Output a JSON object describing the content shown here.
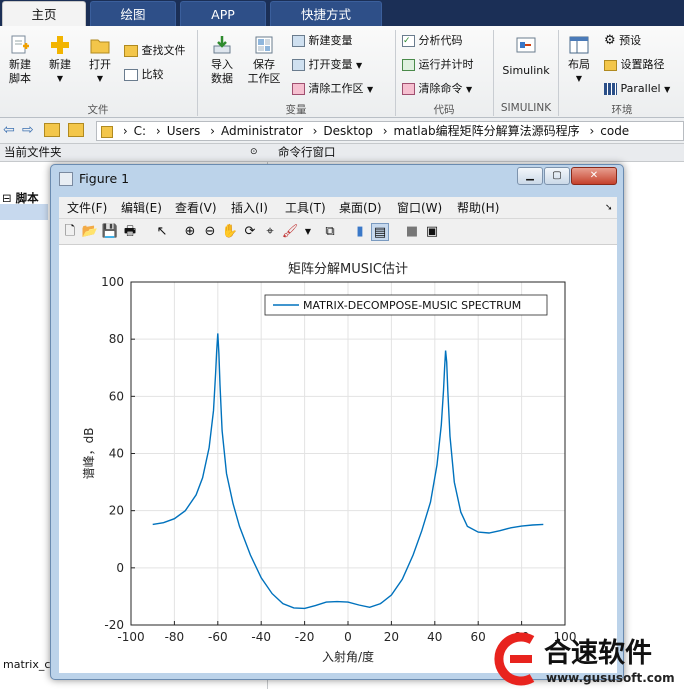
{
  "tabs": [
    {
      "label": "主页",
      "active": true
    },
    {
      "label": "绘图",
      "active": false
    },
    {
      "label": "APP",
      "active": false
    },
    {
      "label": "快捷方式",
      "active": false
    }
  ],
  "ribbon": {
    "file_group": "文件",
    "new_script": "新建\n脚本",
    "new": "新建",
    "open": "打开",
    "find_files": "查找文件",
    "compare": "比较",
    "variable_group": "变量",
    "import_data": "导入\n数据",
    "save_workspace": "保存\n工作区",
    "new_variable": "新建变量",
    "open_variable": "打开变量",
    "clear_workspace": "清除工作区",
    "code_group": "代码",
    "analyze_code": "分析代码",
    "run_and_time": "运行并计时",
    "clear_commands": "清除命令",
    "simulink_group": "SIMULINK",
    "simulink": "Simulink",
    "env_group": "环境",
    "layout": "布局",
    "preferences": "预设",
    "set_path": "设置路径",
    "parallel": "Parallel"
  },
  "address": {
    "path": [
      "C:",
      "Users",
      "Administrator",
      "Desktop",
      "matlab编程矩阵分解算法源码程序",
      "code"
    ]
  },
  "panels": {
    "current_folder": "当前文件夹",
    "command_window": "命令行窗口",
    "tree_root": "脚本",
    "bottom_file": "matrix_c"
  },
  "figure": {
    "title": "Figure 1",
    "menus": [
      "文件(F)",
      "编辑(E)",
      "查看(V)",
      "插入(I)",
      "工具(T)",
      "桌面(D)",
      "窗口(W)",
      "帮助(H)"
    ]
  },
  "chart_data": {
    "type": "line",
    "title": "矩阵分解MUSIC估计",
    "xlabel": "入射角/度",
    "ylabel": "谱峰，dB",
    "xlim": [
      -100,
      100
    ],
    "ylim": [
      -20,
      100
    ],
    "xticks": [
      -100,
      -80,
      -60,
      -40,
      -20,
      0,
      20,
      40,
      60,
      80,
      100
    ],
    "yticks": [
      -20,
      0,
      20,
      40,
      60,
      80,
      100
    ],
    "grid": true,
    "legend_position": "top-right",
    "series": [
      {
        "name": "MATRIX-DECOMPOSE-MUSIC SPECTRUM",
        "color": "#0072bd",
        "x": [
          -90,
          -85,
          -80,
          -75,
          -70,
          -67,
          -64,
          -62,
          -61,
          -60.5,
          -60,
          -59.5,
          -59,
          -58,
          -56,
          -53,
          -50,
          -45,
          -40,
          -35,
          -30,
          -25,
          -20,
          -15,
          -10,
          -5,
          0,
          5,
          10,
          15,
          20,
          25,
          30,
          34,
          38,
          41,
          43,
          44,
          44.5,
          45,
          45.5,
          46,
          47,
          49,
          52,
          55,
          60,
          65,
          70,
          75,
          80,
          85,
          90
        ],
        "y": [
          15.2,
          15.8,
          17.2,
          20.0,
          25.5,
          31.5,
          42.0,
          55.0,
          68.0,
          76.0,
          82.0,
          75.0,
          64.0,
          48.0,
          33.0,
          22.5,
          14.5,
          4.5,
          -3.5,
          -9.0,
          -12.5,
          -14.0,
          -14.2,
          -13.2,
          -12.0,
          -11.8,
          -12.0,
          -13.0,
          -13.8,
          -12.5,
          -9.5,
          -4.0,
          4.5,
          13.0,
          23.0,
          36.0,
          50.0,
          62.0,
          70.0,
          76.0,
          72.0,
          62.0,
          46.0,
          30.0,
          19.5,
          14.5,
          12.5,
          12.2,
          13.0,
          14.0,
          14.6,
          15.0,
          15.2
        ]
      }
    ]
  },
  "watermark": {
    "brand": "合速软件",
    "url": "www.gususoft.com"
  }
}
